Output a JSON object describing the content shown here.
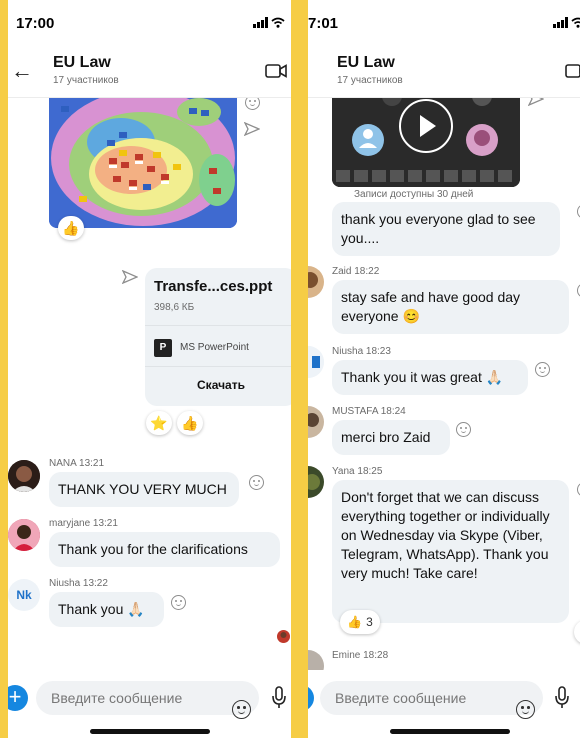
{
  "left": {
    "status_time": "17:00",
    "title": "EU Law",
    "subtitle": "17 участников",
    "file": {
      "name": "Transfe...ces.ppt",
      "size": "398,6 КБ",
      "app": "MS PowerPoint",
      "download": "Скачать",
      "app_icon_letters": "P"
    },
    "reactions": {
      "image": "👍",
      "file_star": "⭐",
      "file_like": "👍"
    },
    "messages": [
      {
        "sender": "NANA 13:21",
        "text": "THANK YOU VERY MUCH"
      },
      {
        "sender": "maryjane 13:21",
        "text": "Thank you for the clarifications"
      },
      {
        "sender": "Niusha 13:22",
        "text": "Thank you 🙏🏻",
        "avatar_initials": "Nk"
      }
    ],
    "input_placeholder": "Введите сообщение"
  },
  "right": {
    "status_time": "7:01",
    "title": "EU Law",
    "subtitle": "17 участников",
    "recording_caption": "Записи доступны 30 дней",
    "messages": [
      {
        "sender": "",
        "text": "thank you everyone glad to see you...."
      },
      {
        "sender": "Zaid 18:22",
        "text": "stay safe and have good day everyone 😊"
      },
      {
        "sender": "Niusha 18:23",
        "text": "Thank you it was great 🙏🏻"
      },
      {
        "sender": "MUSTAFA 18:24",
        "text": "merci bro Zaid"
      },
      {
        "sender": "Yana 18:25",
        "text": "Don't forget that we can discuss everything together or individually on Wednesday via Skype (Viber, Telegram, WhatsApp). Thank you very much! Take care!"
      },
      {
        "sender": "Emine 18:28",
        "text": ""
      }
    ],
    "reaction": {
      "emoji": "👍",
      "count": "3"
    },
    "input_placeholder": "Введите сообщение"
  },
  "colors": {
    "background": "#f6cd45",
    "bubble": "#eef2f5",
    "accent": "#1587e0",
    "header_text": "#111111",
    "meta_text": "#6b6b6b"
  },
  "icons": [
    "back-arrow-icon",
    "video-call-icon",
    "send-icon",
    "smiley-icon",
    "plus-icon",
    "microphone-icon",
    "play-icon",
    "powerpoint-icon",
    "signal-icon",
    "wifi-icon"
  ]
}
